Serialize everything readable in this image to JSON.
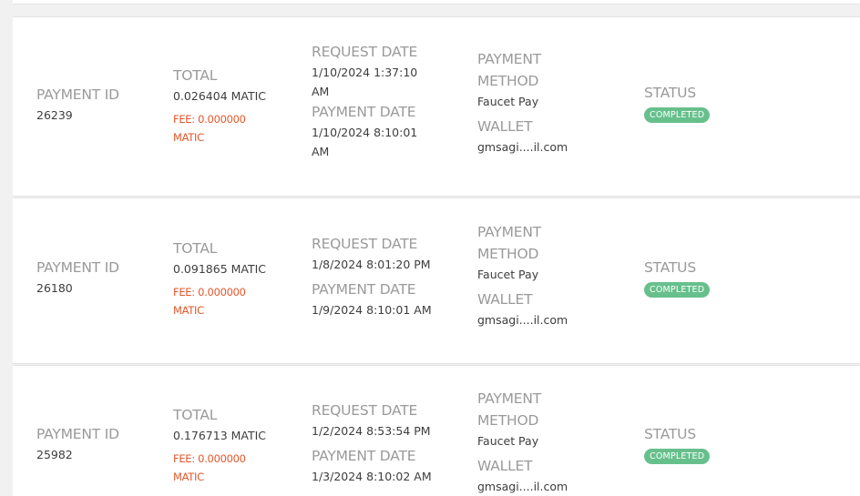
{
  "labels": {
    "payment_id": "PAYMENT ID",
    "total": "TOTAL",
    "request_date": "REQUEST DATE",
    "payment_date": "PAYMENT DATE",
    "payment_method_line1": "PAYMENT",
    "payment_method_line2": "METHOD",
    "wallet": "WALLET",
    "status": "STATUS"
  },
  "colors": {
    "fee_text": "#e2582c",
    "status_badge": "#67c08c",
    "label_text": "#9a9a9a",
    "value_text": "#3d3d3d"
  },
  "payments": [
    {
      "id": "26239",
      "total": "0.026404 MATIC",
      "fee_line1": "FEE: 0.000000",
      "fee_line2": "MATIC",
      "request_date_line1": "1/10/2024 1:37:10",
      "request_date_line2": "AM",
      "payment_date_line1": "1/10/2024 8:10:01",
      "payment_date_line2": "AM",
      "method": "Faucet Pay",
      "wallet": "gmsagi....il.com",
      "status": "COMPLETED"
    },
    {
      "id": "26180",
      "total": "0.091865 MATIC",
      "fee_line1": "FEE: 0.000000",
      "fee_line2": "MATIC",
      "request_date_line1": "1/8/2024 8:01:20 PM",
      "request_date_line2": "",
      "payment_date_line1": "1/9/2024 8:10:01 AM",
      "payment_date_line2": "",
      "method": "Faucet Pay",
      "wallet": "gmsagi....il.com",
      "status": "COMPLETED"
    },
    {
      "id": "25982",
      "total": "0.176713 MATIC",
      "fee_line1": "FEE: 0.000000",
      "fee_line2": "MATIC",
      "request_date_line1": "1/2/2024 8:53:54 PM",
      "request_date_line2": "",
      "payment_date_line1": "1/3/2024 8:10:02 AM",
      "payment_date_line2": "",
      "method": "Faucet Pay",
      "wallet": "gmsagi....il.com",
      "status": "COMPLETED"
    }
  ]
}
